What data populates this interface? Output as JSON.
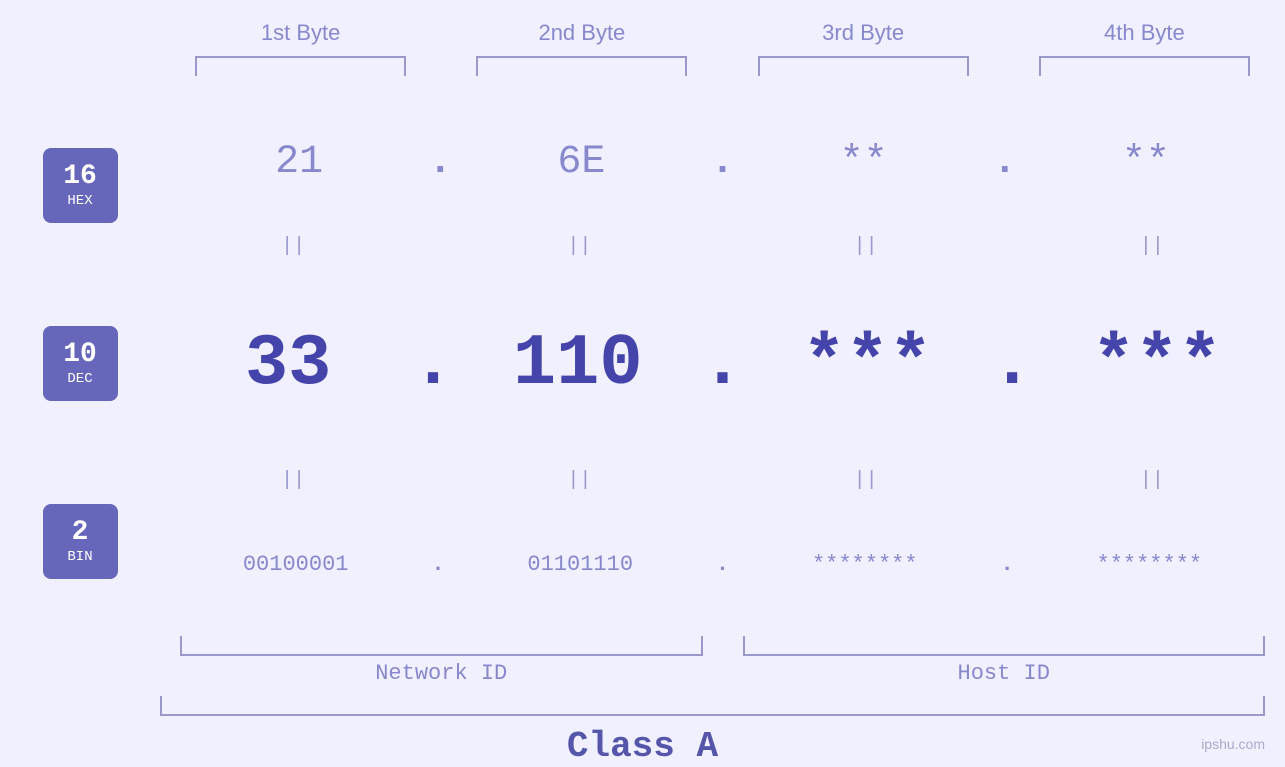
{
  "headers": {
    "col1": "1st Byte",
    "col2": "2nd Byte",
    "col3": "3rd Byte",
    "col4": "4th Byte"
  },
  "badges": {
    "hex": {
      "number": "16",
      "label": "HEX"
    },
    "dec": {
      "number": "10",
      "label": "DEC"
    },
    "bin": {
      "number": "2",
      "label": "BIN"
    }
  },
  "hex_row": {
    "col1": "21",
    "col2": "6E",
    "col3": "**",
    "col4": "**"
  },
  "dec_row": {
    "col1": "33",
    "col2": "110",
    "col3": "***",
    "col4": "***"
  },
  "bin_row": {
    "col1": "00100001",
    "col2": "01101110",
    "col3": "********",
    "col4": "********"
  },
  "labels": {
    "network_id": "Network ID",
    "host_id": "Host ID",
    "class": "Class A"
  },
  "watermark": "ipshu.com",
  "separator": "||",
  "dot": "."
}
